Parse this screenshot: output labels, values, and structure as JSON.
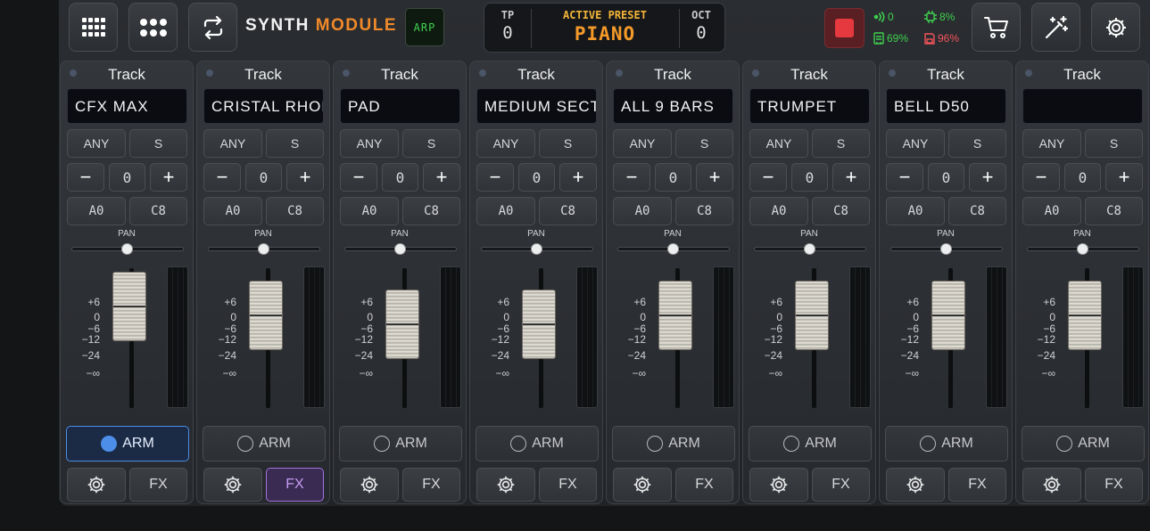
{
  "header": {
    "brand_part1": "SYNTH",
    "brand_part2": "MODULE",
    "arp_label": "ARP",
    "tp_label": "TP",
    "tp_value": "0",
    "preset_label": "ACTIVE PRESET",
    "preset_value": "PIANO",
    "oct_label": "OCT",
    "oct_value": "0",
    "stats": {
      "midi": "0",
      "cpu": "8%",
      "memory": "69%",
      "disk": "96%"
    },
    "icons": [
      "grid-icon",
      "dots-icon",
      "loop-icon",
      "stop-icon",
      "cart-icon",
      "magic-wand-icon",
      "gear-icon"
    ]
  },
  "colors": {
    "accent_orange": "#f08a2a",
    "arp_green": "#3fd14f",
    "arm_blue": "#4d8ee8",
    "fx_purple": "#a473e0",
    "stop_red": "#e5383f"
  },
  "strip_labels": {
    "track": "Track",
    "channel": "ANY",
    "solo": "S",
    "minus": "−",
    "plus": "+",
    "pan": "PAN",
    "arm": "ARM",
    "fx": "FX",
    "scale": [
      "+6",
      "0",
      "−6",
      "−12",
      "−24",
      "−∞"
    ]
  },
  "tracks": [
    {
      "name": "CFX MAX",
      "transpose": "0",
      "low": "A0",
      "high": "C8",
      "armed": true,
      "fx_active": false,
      "fader_level": 0.92
    },
    {
      "name": "CRISTAL RHODES",
      "transpose": "0",
      "low": "A0",
      "high": "C8",
      "armed": false,
      "fx_active": true,
      "fader_level": 0.8
    },
    {
      "name": "PAD",
      "transpose": "0",
      "low": "A0",
      "high": "C8",
      "armed": false,
      "fx_active": false,
      "fader_level": 0.68
    },
    {
      "name": "MEDIUM SECTION",
      "transpose": "0",
      "low": "A0",
      "high": "C8",
      "armed": false,
      "fx_active": false,
      "fader_level": 0.68
    },
    {
      "name": "ALL 9 BARS",
      "transpose": "0",
      "low": "A0",
      "high": "C8",
      "armed": false,
      "fx_active": false,
      "fader_level": 0.8
    },
    {
      "name": "TRUMPET",
      "transpose": "0",
      "low": "A0",
      "high": "C8",
      "armed": false,
      "fx_active": false,
      "fader_level": 0.8
    },
    {
      "name": "BELL D50",
      "transpose": "0",
      "low": "A0",
      "high": "C8",
      "armed": false,
      "fx_active": false,
      "fader_level": 0.8
    },
    {
      "name": "",
      "transpose": "0",
      "low": "A0",
      "high": "C8",
      "armed": false,
      "fx_active": false,
      "fader_level": 0.8
    }
  ]
}
